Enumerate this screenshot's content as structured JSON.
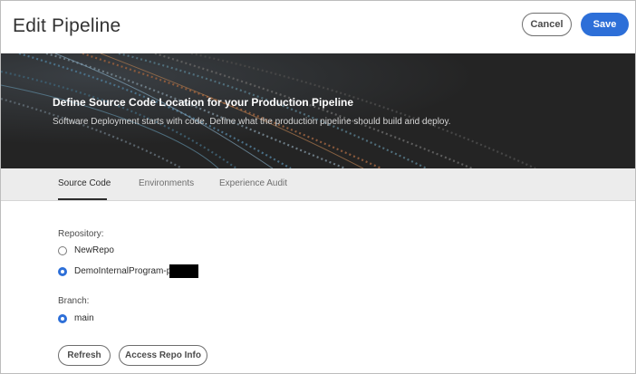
{
  "header": {
    "title": "Edit Pipeline",
    "cancel_label": "Cancel",
    "save_label": "Save"
  },
  "hero": {
    "title": "Define Source Code Location for your Production Pipeline",
    "subtitle": "Software Deployment starts with code. Define what the production pipeline should build and deploy."
  },
  "tabs": [
    {
      "label": "Source Code",
      "active": true
    },
    {
      "label": "Environments",
      "active": false
    },
    {
      "label": "Experience Audit",
      "active": false
    }
  ],
  "repository": {
    "label": "Repository:",
    "options": [
      {
        "label": "NewRepo",
        "selected": false
      },
      {
        "label": "DemoInternalProgram-p",
        "selected": true
      }
    ]
  },
  "branch": {
    "label": "Branch:",
    "options": [
      {
        "label": "main",
        "selected": true
      }
    ]
  },
  "actions": {
    "refresh_label": "Refresh",
    "repo_info_label": "Access Repo Info"
  },
  "colors": {
    "accent": "#2d6fd8",
    "hero_bg": "#242424",
    "tabs_bg": "#ececec"
  }
}
